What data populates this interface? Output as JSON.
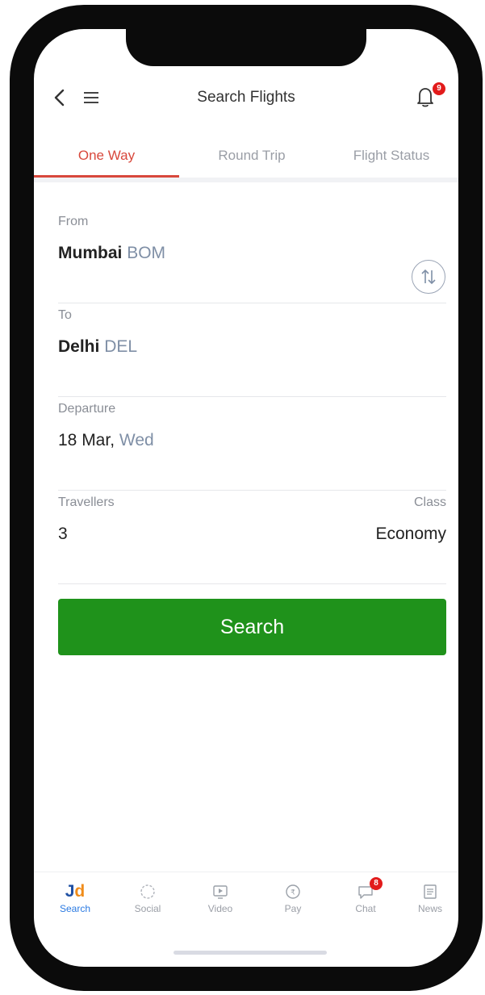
{
  "header": {
    "title": "Search Flights",
    "notification_count": "9"
  },
  "tabs": [
    {
      "label": "One Way",
      "active": true
    },
    {
      "label": "Round Trip",
      "active": false
    },
    {
      "label": "Flight Status",
      "active": false
    }
  ],
  "form": {
    "from": {
      "label": "From",
      "city": "Mumbai",
      "code": "BOM"
    },
    "to": {
      "label": "To",
      "city": "Delhi",
      "code": "DEL"
    },
    "departure": {
      "label": "Departure",
      "date": "18 Mar,",
      "day": "Wed"
    },
    "travellers": {
      "label": "Travellers",
      "value": "3"
    },
    "class": {
      "label": "Class",
      "value": "Economy"
    }
  },
  "search_button": {
    "label": "Search"
  },
  "bottom_nav": {
    "items": [
      {
        "label": "Search",
        "icon": "jd-logo",
        "active": true
      },
      {
        "label": "Social",
        "icon": "social-icon"
      },
      {
        "label": "Video",
        "icon": "video-icon"
      },
      {
        "label": "Pay",
        "icon": "rupee-icon"
      },
      {
        "label": "Chat",
        "icon": "chat-icon",
        "badge": "8"
      },
      {
        "label": "News",
        "icon": "news-icon"
      }
    ]
  },
  "colors": {
    "accent_red": "#d8483c",
    "search_green": "#1f921b",
    "active_blue": "#2a7ae2"
  }
}
